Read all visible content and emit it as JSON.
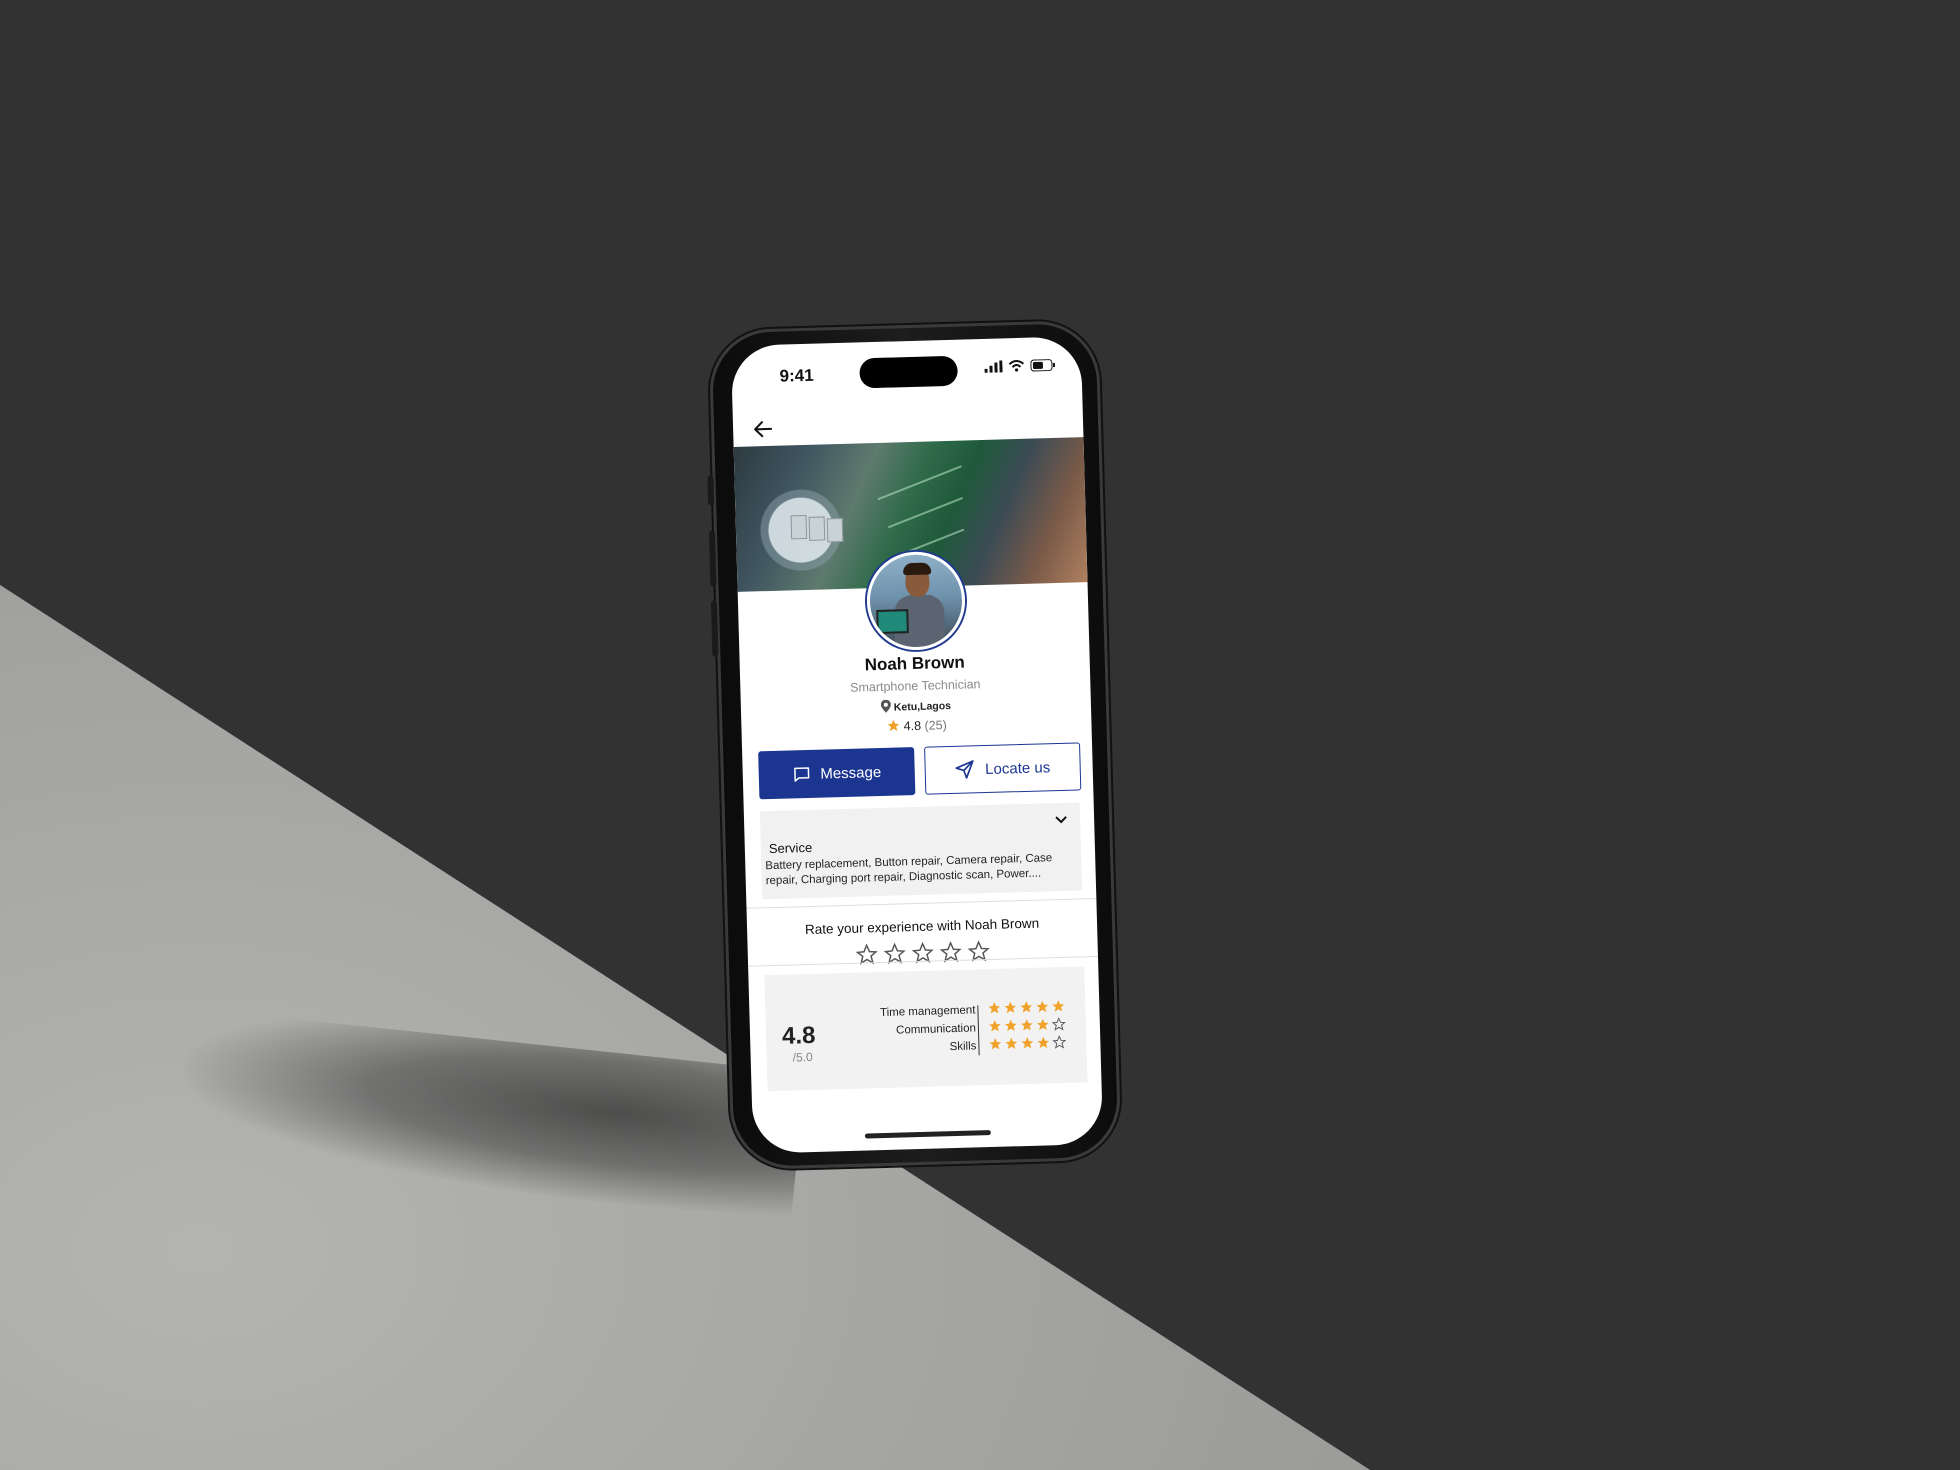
{
  "status_bar": {
    "time": "9:41"
  },
  "profile": {
    "name": "Noah Brown",
    "role": "Smartphone Technician",
    "location": "Ketu,Lagos",
    "rating": "4.8",
    "review_count": "(25)"
  },
  "actions": {
    "message_label": "Message",
    "locate_label": "Locate us"
  },
  "service": {
    "title": "Service",
    "text": "Battery replacement, Button repair, Camera repair, Case repair, Charging port repair, Diagnostic scan, Power...."
  },
  "rate": {
    "prompt": "Rate your experience with Noah Brown",
    "stars_total": 5,
    "stars_selected": 0
  },
  "summary": {
    "score": "4.8",
    "out_of": "/5.0",
    "criteria": [
      {
        "label": "Time management",
        "stars": 5
      },
      {
        "label": "Communication",
        "stars": 4
      },
      {
        "label": "Skills",
        "stars": 4
      }
    ]
  },
  "colors": {
    "primary": "#1b3591",
    "star": "#f0a22a",
    "background": "#323232"
  },
  "icons": {
    "back": "arrow-left-icon",
    "location": "map-pin-icon",
    "message": "chat-bubble-icon",
    "locate": "send-arrow-icon",
    "expand": "chevron-down-icon"
  }
}
